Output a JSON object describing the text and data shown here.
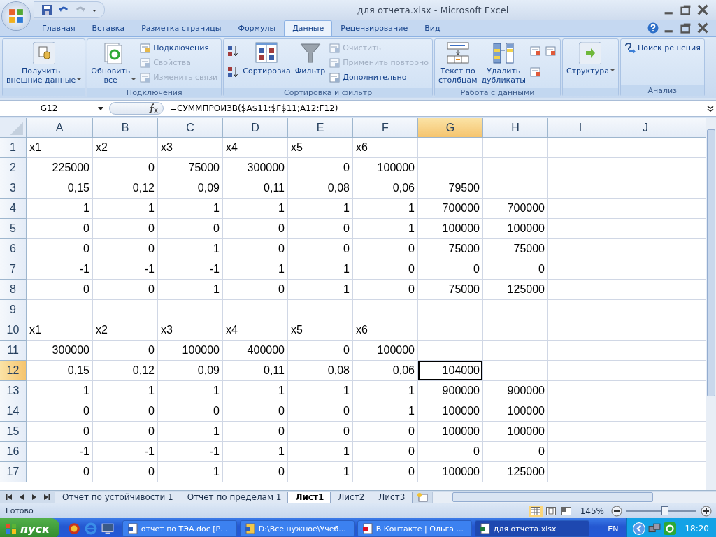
{
  "window": {
    "title": "для отчета.xlsx - Microsoft Excel"
  },
  "tabs": [
    {
      "label": "Главная",
      "selected": false
    },
    {
      "label": "Вставка",
      "selected": false
    },
    {
      "label": "Разметка страницы",
      "selected": false
    },
    {
      "label": "Формулы",
      "selected": false
    },
    {
      "label": "Данные",
      "selected": true
    },
    {
      "label": "Рецензирование",
      "selected": false
    },
    {
      "label": "Вид",
      "selected": false
    }
  ],
  "ribbon": {
    "groups": [
      {
        "items": [
          {
            "kind": "large",
            "label": "Получить\nвнешние данные",
            "dropdown": true,
            "disabled": false
          }
        ]
      },
      {
        "label": "Подключения",
        "items": [
          {
            "kind": "large",
            "label": "Обновить\nвсе",
            "dropdown": true,
            "disabled": false
          },
          {
            "kind": "small",
            "label": "Подключения",
            "disabled": false
          },
          {
            "kind": "small",
            "label": "Свойства",
            "disabled": true
          },
          {
            "kind": "small",
            "label": "Изменить связи",
            "disabled": true
          }
        ]
      },
      {
        "label": "Сортировка и фильтр",
        "items": [
          {
            "kind": "icon",
            "disabled": false
          },
          {
            "kind": "icon",
            "disabled": false
          },
          {
            "kind": "large",
            "label": "Сортировка",
            "dropdown": false,
            "disabled": false
          },
          {
            "kind": "large",
            "label": "Фильтр",
            "dropdown": false,
            "disabled": false
          },
          {
            "kind": "small",
            "label": "Очистить",
            "disabled": true
          },
          {
            "kind": "small",
            "label": "Применить повторно",
            "disabled": true
          },
          {
            "kind": "small",
            "label": "Дополнительно",
            "disabled": false
          }
        ]
      },
      {
        "label": "Работа с данными",
        "items": [
          {
            "kind": "large",
            "label": "Текст по\nстолбцам",
            "dropdown": false,
            "disabled": false
          },
          {
            "kind": "large",
            "label": "Удалить\nдубликаты",
            "dropdown": false,
            "disabled": false
          },
          {
            "kind": "icon",
            "disabled": false
          },
          {
            "kind": "icon",
            "disabled": false
          },
          {
            "kind": "icon",
            "disabled": false
          }
        ]
      },
      {
        "items": [
          {
            "kind": "large",
            "label": "Структура",
            "dropdown": true,
            "disabled": false
          }
        ]
      },
      {
        "label": "Анализ",
        "items": [
          {
            "kind": "small",
            "label": "Поиск решения",
            "disabled": false
          }
        ]
      }
    ]
  },
  "formula_bar": {
    "name_box": "G12",
    "formula": "=СУММПРОИЗВ($A$11:$F$11;A12:F12)"
  },
  "columns": [
    {
      "label": "A",
      "selected": false
    },
    {
      "label": "B",
      "selected": false
    },
    {
      "label": "C",
      "selected": false
    },
    {
      "label": "D",
      "selected": false
    },
    {
      "label": "E",
      "selected": false
    },
    {
      "label": "F",
      "selected": false
    },
    {
      "label": "G",
      "selected": true
    },
    {
      "label": "H",
      "selected": false
    },
    {
      "label": "I",
      "selected": false
    },
    {
      "label": "J",
      "selected": false
    }
  ],
  "rows": [
    {
      "label": "1",
      "selected": false,
      "kind": "labels",
      "cells": [
        "x1",
        "x2",
        "x3",
        "x4",
        "x5",
        "x6",
        null,
        null
      ]
    },
    {
      "label": "2",
      "selected": false,
      "kind": "numbers",
      "cells": [
        "225000",
        "0",
        "75000",
        "300000",
        "0",
        "100000",
        null,
        null
      ]
    },
    {
      "label": "3",
      "selected": false,
      "kind": "numbers",
      "cells": [
        "0,15",
        "0,12",
        "0,09",
        "0,11",
        "0,08",
        "0,06",
        "79500",
        null
      ]
    },
    {
      "label": "4",
      "selected": false,
      "kind": "numbers",
      "cells": [
        "1",
        "1",
        "1",
        "1",
        "1",
        "1",
        "700000",
        "700000"
      ]
    },
    {
      "label": "5",
      "selected": false,
      "kind": "numbers",
      "cells": [
        "0",
        "0",
        "0",
        "0",
        "0",
        "1",
        "100000",
        "100000"
      ]
    },
    {
      "label": "6",
      "selected": false,
      "kind": "numbers",
      "cells": [
        "0",
        "0",
        "1",
        "0",
        "0",
        "0",
        "75000",
        "75000"
      ]
    },
    {
      "label": "7",
      "selected": false,
      "kind": "numbers",
      "cells": [
        "-1",
        "-1",
        "-1",
        "1",
        "1",
        "0",
        "0",
        "0"
      ]
    },
    {
      "label": "8",
      "selected": false,
      "kind": "numbers",
      "cells": [
        "0",
        "0",
        "1",
        "0",
        "1",
        "0",
        "75000",
        "125000"
      ]
    },
    {
      "label": "9",
      "selected": false,
      "kind": "numbers",
      "cells": [
        null,
        null,
        null,
        null,
        null,
        null,
        null,
        null
      ]
    },
    {
      "label": "10",
      "selected": false,
      "kind": "labels",
      "cells": [
        "x1",
        "x2",
        "x3",
        "x4",
        "x5",
        "x6",
        null,
        null
      ]
    },
    {
      "label": "11",
      "selected": false,
      "kind": "numbers",
      "cells": [
        "300000",
        "0",
        "100000",
        "400000",
        "0",
        "100000",
        null,
        null
      ]
    },
    {
      "label": "12",
      "selected": true,
      "kind": "numbers",
      "cells": [
        "0,15",
        "0,12",
        "0,09",
        "0,11",
        "0,08",
        "0,06",
        "104000",
        null
      ]
    },
    {
      "label": "13",
      "selected": false,
      "kind": "numbers",
      "cells": [
        "1",
        "1",
        "1",
        "1",
        "1",
        "1",
        "900000",
        "900000"
      ]
    },
    {
      "label": "14",
      "selected": false,
      "kind": "numbers",
      "cells": [
        "0",
        "0",
        "0",
        "0",
        "0",
        "1",
        "100000",
        "100000"
      ]
    },
    {
      "label": "15",
      "selected": false,
      "kind": "numbers",
      "cells": [
        "0",
        "0",
        "1",
        "0",
        "0",
        "0",
        "100000",
        "100000"
      ]
    },
    {
      "label": "16",
      "selected": false,
      "kind": "numbers",
      "cells": [
        "-1",
        "-1",
        "-1",
        "1",
        "1",
        "0",
        "0",
        "0"
      ]
    },
    {
      "label": "17",
      "selected": false,
      "kind": "numbers",
      "cells": [
        "0",
        "0",
        "1",
        "0",
        "1",
        "0",
        "100000",
        "125000"
      ]
    }
  ],
  "sheet_tabs": [
    {
      "label": "Отчет по устойчивости 1",
      "selected": false
    },
    {
      "label": "Отчет по пределам 1",
      "selected": false
    },
    {
      "label": "Лист1",
      "selected": true
    },
    {
      "label": "Лист2",
      "selected": false
    },
    {
      "label": "Лист3",
      "selected": false
    }
  ],
  "status_bar": {
    "status": "Готово",
    "zoom": "145%",
    "zoom_slider": {
      "level": 0.55
    }
  },
  "taskbar": {
    "start": "пуск",
    "tasks": [
      {
        "label": "отчет по ТЭА.doc [Р...",
        "selected": false
      },
      {
        "label": "D:\\Все нужное\\Учеб...",
        "selected": false
      },
      {
        "label": "В Контакте | Ольга ...",
        "selected": false
      },
      {
        "label": "для отчета.xlsx",
        "selected": true
      }
    ],
    "language": "EN",
    "time": "18:20"
  }
}
